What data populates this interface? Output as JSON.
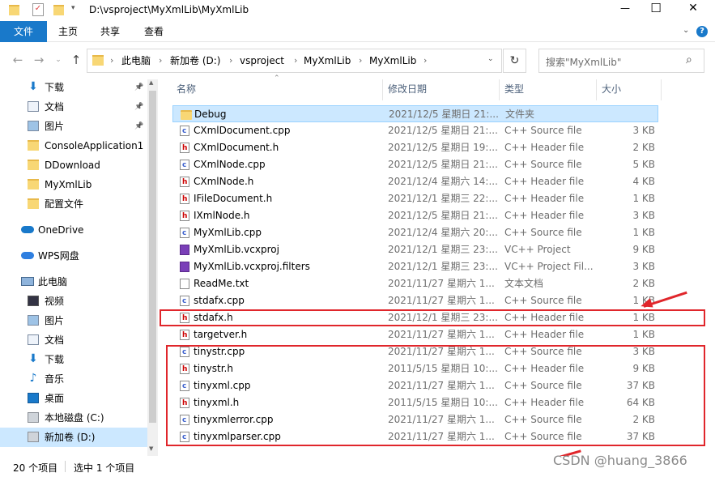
{
  "window": {
    "title": "D:\\vsproject\\MyXmlLib\\MyXmlLib",
    "controls": [
      "—",
      "☐",
      "✕"
    ]
  },
  "ribbon": {
    "tabs": [
      "文件",
      "主页",
      "共享",
      "查看"
    ]
  },
  "address": {
    "crumbs": [
      "此电脑",
      "新加卷 (D:)",
      "vsproject",
      "MyXmlLib",
      "MyXmlLib"
    ],
    "search_placeholder": "搜索\"MyXmlLib\""
  },
  "sidebar": {
    "quick": [
      {
        "label": "下载",
        "icon": "download-icon",
        "pinned": true
      },
      {
        "label": "文档",
        "icon": "document-icon",
        "pinned": true
      },
      {
        "label": "图片",
        "icon": "picture-icon",
        "pinned": true
      },
      {
        "label": "ConsoleApplication1",
        "icon": "folder-icon",
        "pinned": false
      },
      {
        "label": "DDownload",
        "icon": "folder-icon",
        "pinned": false
      },
      {
        "label": "MyXmlLib",
        "icon": "folder-icon",
        "pinned": false
      },
      {
        "label": "配置文件",
        "icon": "folder-icon",
        "pinned": false
      }
    ],
    "onedrive": "OneDrive",
    "wps": "WPS网盘",
    "thispc": "此电脑",
    "pc_items": [
      {
        "label": "视频",
        "icon": "video-icon"
      },
      {
        "label": "图片",
        "icon": "picture-icon"
      },
      {
        "label": "文档",
        "icon": "document-icon"
      },
      {
        "label": "下载",
        "icon": "download-icon"
      },
      {
        "label": "音乐",
        "icon": "music-icon"
      },
      {
        "label": "桌面",
        "icon": "desktop-icon"
      },
      {
        "label": "本地磁盘 (C:)",
        "icon": "drive-icon"
      },
      {
        "label": "新加卷 (D:)",
        "icon": "drive-icon"
      }
    ]
  },
  "columns": {
    "name": "名称",
    "date": "修改日期",
    "type": "类型",
    "size": "大小"
  },
  "files": [
    {
      "name": "Debug",
      "date": "2021/12/5 星期日 21:...",
      "type": "文件夹",
      "size": "",
      "icon": "folder-icon"
    },
    {
      "name": "CXmlDocument.cpp",
      "date": "2021/12/5 星期日 21:...",
      "type": "C++ Source file",
      "size": "3 KB",
      "icon": "cpp-file-icon"
    },
    {
      "name": "CXmlDocument.h",
      "date": "2021/12/5 星期日 19:...",
      "type": "C++ Header file",
      "size": "2 KB",
      "icon": "header-file-icon"
    },
    {
      "name": "CXmlNode.cpp",
      "date": "2021/12/5 星期日 21:...",
      "type": "C++ Source file",
      "size": "5 KB",
      "icon": "cpp-file-icon"
    },
    {
      "name": "CXmlNode.h",
      "date": "2021/12/4 星期六 14:...",
      "type": "C++ Header file",
      "size": "4 KB",
      "icon": "header-file-icon"
    },
    {
      "name": "IFileDocument.h",
      "date": "2021/12/1 星期三 22:...",
      "type": "C++ Header file",
      "size": "1 KB",
      "icon": "header-file-icon"
    },
    {
      "name": "IXmlNode.h",
      "date": "2021/12/5 星期日 21:...",
      "type": "C++ Header file",
      "size": "3 KB",
      "icon": "header-file-icon"
    },
    {
      "name": "MyXmlLib.cpp",
      "date": "2021/12/4 星期六 20:...",
      "type": "C++ Source file",
      "size": "1 KB",
      "icon": "cpp-file-icon"
    },
    {
      "name": "MyXmlLib.vcxproj",
      "date": "2021/12/1 星期三 23:...",
      "type": "VC++ Project",
      "size": "9 KB",
      "icon": "project-file-icon"
    },
    {
      "name": "MyXmlLib.vcxproj.filters",
      "date": "2021/12/1 星期三 23:...",
      "type": "VC++ Project Fil...",
      "size": "3 KB",
      "icon": "project-file-icon"
    },
    {
      "name": "ReadMe.txt",
      "date": "2021/11/27 星期六 1...",
      "type": "文本文档",
      "size": "2 KB",
      "icon": "text-file-icon"
    },
    {
      "name": "stdafx.cpp",
      "date": "2021/11/27 星期六 1...",
      "type": "C++ Source file",
      "size": "1 KB",
      "icon": "cpp-file-icon"
    },
    {
      "name": "stdafx.h",
      "date": "2021/12/1 星期三 23:...",
      "type": "C++ Header file",
      "size": "1 KB",
      "icon": "header-file-icon"
    },
    {
      "name": "targetver.h",
      "date": "2021/11/27 星期六 1...",
      "type": "C++ Header file",
      "size": "1 KB",
      "icon": "header-file-icon"
    },
    {
      "name": "tinystr.cpp",
      "date": "2021/11/27 星期六 1...",
      "type": "C++ Source file",
      "size": "3 KB",
      "icon": "cpp-file-icon"
    },
    {
      "name": "tinystr.h",
      "date": "2011/5/15 星期日 10:...",
      "type": "C++ Header file",
      "size": "9 KB",
      "icon": "header-file-icon"
    },
    {
      "name": "tinyxml.cpp",
      "date": "2021/11/27 星期六 1...",
      "type": "C++ Source file",
      "size": "37 KB",
      "icon": "cpp-file-icon"
    },
    {
      "name": "tinyxml.h",
      "date": "2011/5/15 星期日 10:...",
      "type": "C++ Header file",
      "size": "64 KB",
      "icon": "header-file-icon"
    },
    {
      "name": "tinyxmlerror.cpp",
      "date": "2021/11/27 星期六 1...",
      "type": "C++ Source file",
      "size": "2 KB",
      "icon": "cpp-file-icon"
    },
    {
      "name": "tinyxmlparser.cpp",
      "date": "2021/11/27 星期六 1...",
      "type": "C++ Source file",
      "size": "37 KB",
      "icon": "cpp-file-icon"
    }
  ],
  "status": {
    "count": "20 个项目",
    "selected": "选中 1 个项目"
  },
  "watermark": "CSDN @huang_3866",
  "colors": {
    "accent": "#1979ca",
    "annotation": "#e0262b",
    "selection": "#cce8ff"
  }
}
